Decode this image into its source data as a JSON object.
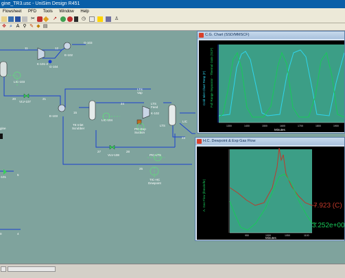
{
  "window": {
    "title": "gine_TR3.usc - UniSim Design R451"
  },
  "menu": [
    "Flowsheet",
    "PFD",
    "Tools",
    "Window",
    "Help"
  ],
  "pfd_labels": {
    "s11": "11",
    "s12": "12",
    "k1012": "K-101-2",
    "e102": "E-102",
    "g103": "G-103",
    "g104": "G-104",
    "lic103": "LIC-103",
    "s20": "20",
    "vlv107": "VLV-107",
    "s21": "21",
    "e103": "E-103",
    "s15": "15",
    "te_inlet_a": "TE Inlet",
    "te_inlet_b": "Scrubber",
    "lic104": "LIC-104",
    "lts_vap_a": "LTS",
    "lts_vap_b": "Vap",
    "s24": "24",
    "lts_feed_a": "LTS",
    "lts_feed_b": "Feed",
    "k102": "K-102",
    "lts": "LTS",
    "lic": "LIC",
    "pic_exp_a": "PIC-Exp",
    "pic_exp_b": "Suction",
    "s27": "27",
    "s28": "28",
    "vlv108": "VLV-108",
    "pic_lts": "PIC-LTS",
    "s25": "25",
    "s23": "23",
    "tic_hc_a": "TIC-HC",
    "tic_hc_b": "Dewpoint",
    "engine_partial": "gine",
    "left_101": "-101",
    "s5": "5",
    "s4": "4",
    "s0": "0"
  },
  "chart1": {
    "title": "C.G. Chart (SSD/MMSCF)",
    "ylabel_left": "Cold Inlet Chart Temp (F)",
    "ylabel_right": "Full Range Separator - Thermal Gain (SCF)",
    "xlabel": "Minutes",
    "x_ticks": [
      "1300",
      "1400",
      "1500",
      "1600",
      "1700",
      "1800",
      "1900"
    ]
  },
  "chart2": {
    "title": "H.C. Dewpoint & Exp Gas Flow",
    "ylabel_left": "A. Gas Flow (lbmole/hr)",
    "xlabel": "Minutes",
    "x_ticks": [
      "950",
      "1000",
      "1050",
      "1100"
    ],
    "readout_red": "7.923 (C)",
    "readout_green": "3.252e+00"
  },
  "colors": {
    "title_blue": "#0a5fa8",
    "pfd_bg": "#7fa39d",
    "stream": "#1a3fd0",
    "plot_cyan": "#2fd5ee",
    "plot_green": "#19c95a",
    "plot_red": "#c0392b"
  }
}
